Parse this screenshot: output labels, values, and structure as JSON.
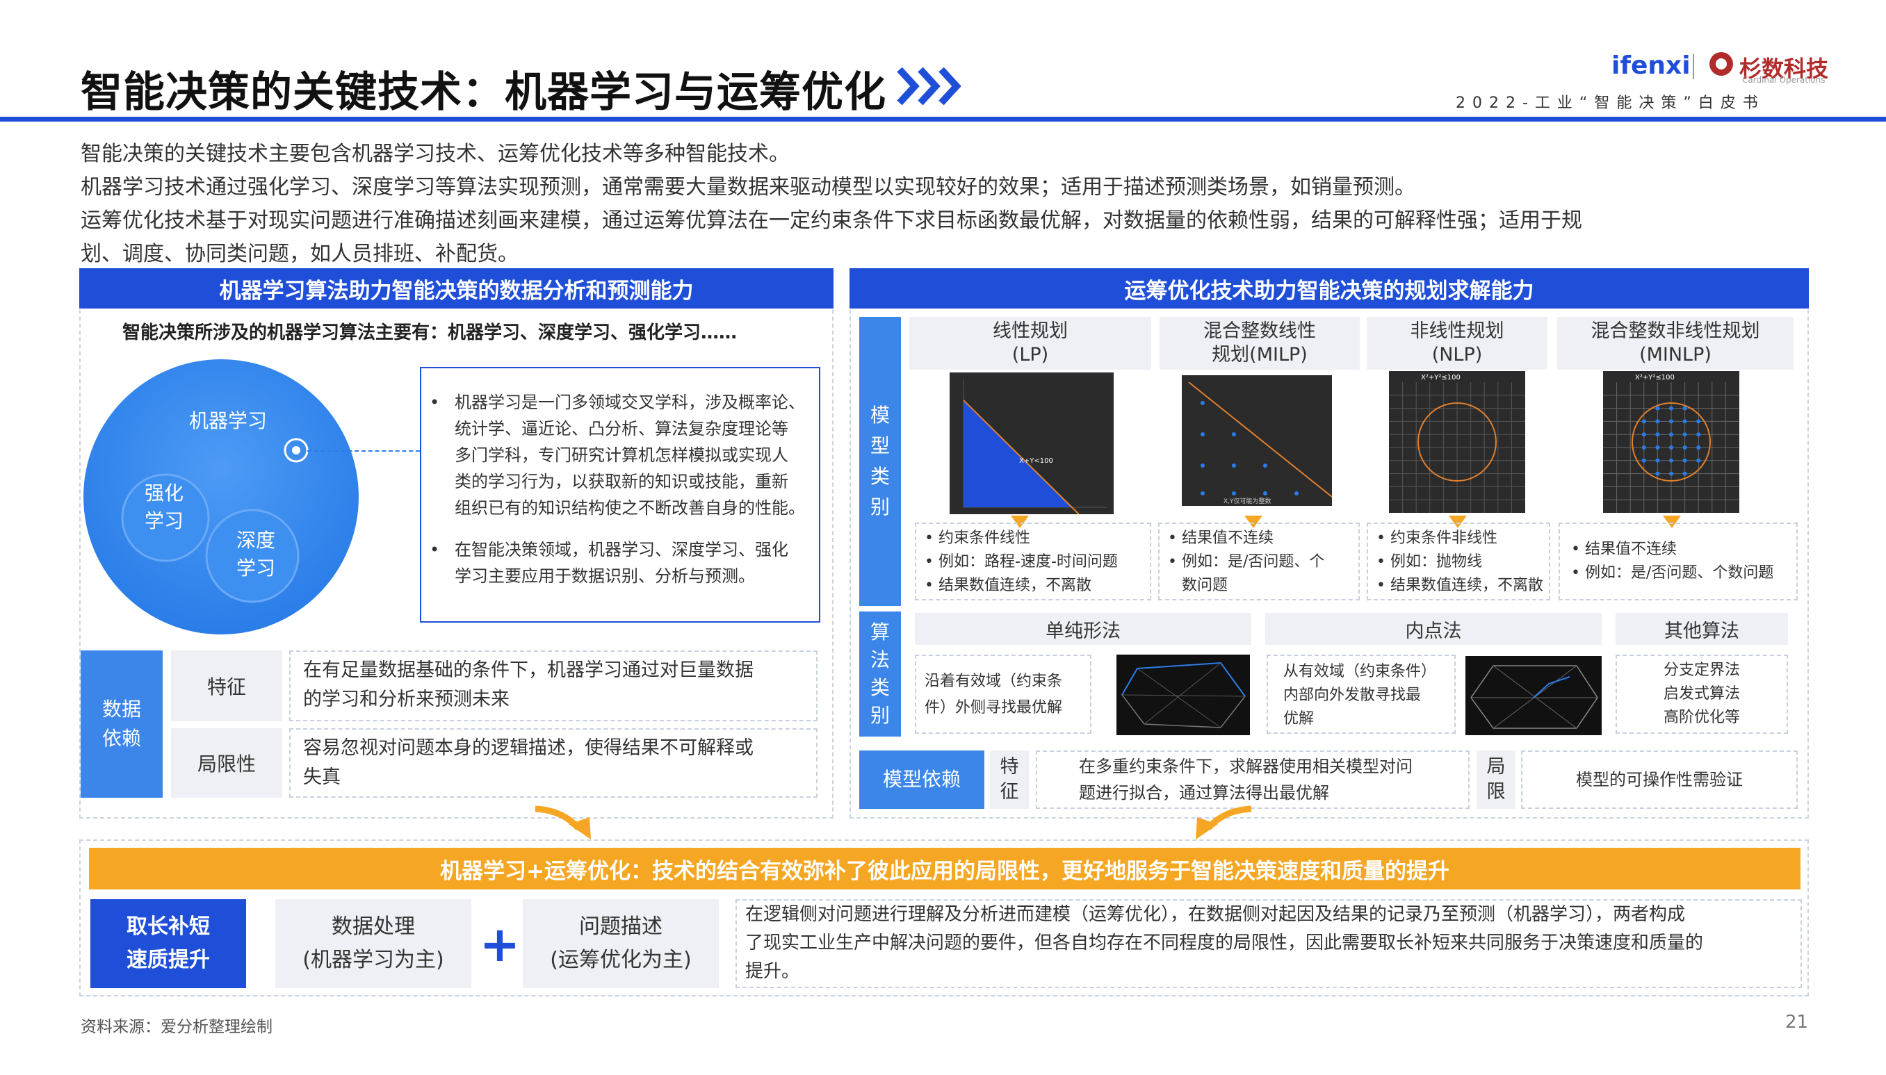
{
  "header": {
    "title": "智能决策的关键技术：机器学习与运筹优化",
    "logo_ifenxi": "ifenxi",
    "logo_partner": "杉数科技",
    "logo_partner_en": "Cardinal Operations",
    "subtitle": "2022-工业“智能决策”白皮书"
  },
  "intro": [
    "智能决策的关键技术主要包含机器学习技术、运筹优化技术等多种智能技术。",
    "机器学习技术通过强化学习、深度学习等算法实现预测，通常需要大量数据来驱动模型以实现较好的效果；适用于描述预测类场景，如销量预测。",
    "运筹优化技术基于对现实问题进行准确描述刻画来建模，通过运筹优算法在一定约束条件下求目标函数最优解，对数据量的依赖性弱，结果的可解释性强；适用于规",
    "划、调度、协同类问题，如人员排班、补配货。"
  ],
  "left": {
    "header": "机器学习算法助力智能决策的数据分析和预测能力",
    "subheader": "智能决策所涉及的机器学习算法主要有：机器学习、深度学习、强化学习……",
    "circle_main": "机器学习",
    "circle_a": [
      "强化",
      "学习"
    ],
    "circle_b": [
      "深度",
      "学习"
    ],
    "bullets": [
      [
        "机器学习是一门多领域交叉学科，涉及概率论、",
        "统计学、逼近论、凸分析、算法复杂度理论等",
        "多门学科，专门研究计算机怎样模拟或实现人",
        "类的学习行为，以获取新的知识或技能，重新",
        "组织已有的知识结构使之不断改善自身的性能。"
      ],
      [
        "在智能决策领域，机器学习、深度学习、强化",
        "学习主要应用于数据识别、分析与预测。"
      ]
    ],
    "dep_label": [
      "数据",
      "依赖"
    ],
    "feature_label": "特征",
    "feature_text": [
      "在有足量数据基础的条件下，机器学习通过对巨量数据",
      "的学习和分析来预测未来"
    ],
    "limit_label": "局限性",
    "limit_text": [
      "容易忽视对问题本身的逻辑描述，使得结果不可解释或",
      "失真"
    ]
  },
  "right": {
    "header": "运筹优化技术助力智能决策的规划求解能力",
    "model_label": [
      "模",
      "型",
      "类",
      "别"
    ],
    "models": [
      {
        "name": [
          "线性规划",
          "(LP)"
        ],
        "bullets": [
          "约束条件线性",
          "例如：路程-速度-时间问题",
          "结果数值连续，不离散"
        ],
        "chart_text": "X+Y<100"
      },
      {
        "name": [
          "混合整数线性",
          "规划(MILP)"
        ],
        "bullets": [
          "结果值不连续",
          "例如：是/否问题、个",
          "数问题"
        ],
        "chart_text": "X,Y仅可能为整数"
      },
      {
        "name": [
          "非线性规划",
          "(NLP)"
        ],
        "bullets": [
          "约束条件非线性",
          "例如：抛物线",
          "结果数值连续，不离散"
        ],
        "chart_text": "X²+Y²≤100"
      },
      {
        "name": [
          "混合整数非线性规划",
          "(MINLP)"
        ],
        "bullets": [
          "结果值不连续",
          "例如：是/否问题、个数问题"
        ],
        "chart_text": "X²+Y²≤100"
      }
    ],
    "algo_label": [
      "算",
      "法",
      "类",
      "别"
    ],
    "algos": [
      {
        "name": "单纯形法",
        "desc": [
          "沿着有效域（约束条",
          "件）外侧寻找最优解"
        ]
      },
      {
        "name": "内点法",
        "desc": [
          "从有效域（约束条件）",
          "内部向外发散寻找最",
          "优解"
        ]
      },
      {
        "name": "其他算法",
        "desc": [
          "分支定界法",
          "启发式算法",
          "高阶优化等"
        ]
      }
    ],
    "dep_label": "模型依赖",
    "feature_label": [
      "特",
      "征"
    ],
    "feature_text": [
      "在多重约束条件下，求解器使用相关模型对问",
      "题进行拟合，通过算法得出最优解"
    ],
    "limit_label": [
      "局",
      "限"
    ],
    "limit_text": "模型的可操作性需验证"
  },
  "bottom": {
    "banner": "机器学习+运筹优化：技术的结合有效弥补了彼此应用的局限性，更好地服务于智能决策速度和质量的提升",
    "label": [
      "取长补短",
      "速质提升"
    ],
    "box1": [
      "数据处理",
      "(机器学习为主)"
    ],
    "plus": "+",
    "box2": [
      "问题描述",
      "(运筹优化为主)"
    ],
    "text": [
      "在逻辑侧对问题进行理解及分析进而建模（运筹优化），在数据侧对起因及结果的记录乃至预测（机器学习），两者构成",
      "了现实工业生产中解决问题的要件，但各自均存在不同程度的局限性，因此需要取长补短来共同服务于决策速度和质量的",
      "提升。"
    ]
  },
  "footer": {
    "source": "资料来源：爱分析整理绘制",
    "page": "21"
  },
  "colors": {
    "primary": "#1f4fd8",
    "light_blue": "#3b86e8",
    "orange": "#f5a623"
  }
}
